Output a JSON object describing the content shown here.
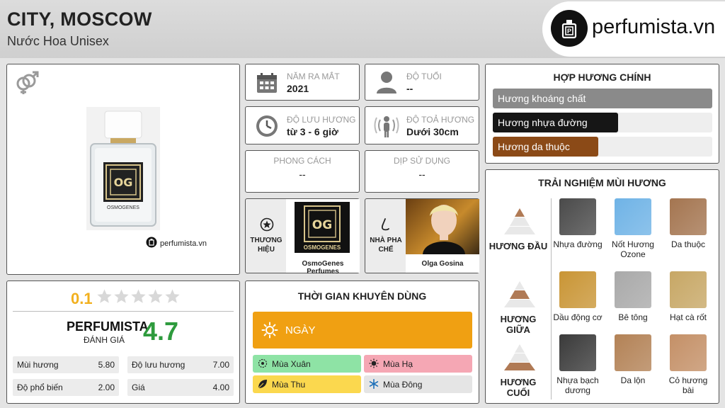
{
  "header": {
    "title": "CITY, MOSCOW",
    "subtitle": "Nước Hoa Unisex",
    "logo_text": "perfumista.vn"
  },
  "product": {
    "watermark": "perfumista.vn",
    "bottle_brand": "OSMOGENES"
  },
  "info": {
    "release_year": {
      "label": "NĂM RA MẮT",
      "value": "2021"
    },
    "age": {
      "label": "ĐỘ TUỔI",
      "value": "--"
    },
    "longevity": {
      "label": "ĐỘ LƯU HƯƠNG",
      "value": "từ 3 - 6 giờ"
    },
    "sillage": {
      "label": "ĐỘ TOẢ HƯƠNG",
      "value": "Dưới 30cm"
    },
    "style": {
      "label": "PHONG CÁCH",
      "value": "--"
    },
    "occasion": {
      "label": "DỊP SỬ DỤNG",
      "value": "--"
    },
    "brand": {
      "label_line1": "THƯƠNG",
      "label_line2": "HIỆU",
      "name": "OsmoGenes Perfumes",
      "logo_text": "OSMOGENES"
    },
    "perfumer": {
      "label_line1": "NHÀ PHA",
      "label_line2": "CHẾ",
      "name": "Olga Gosina"
    }
  },
  "accords": {
    "title": "HỢP HƯƠNG CHÍNH",
    "items": [
      {
        "label": "Hương khoáng chất",
        "fraction": 1.0,
        "color": "#8a8a8a"
      },
      {
        "label": "Hương nhựa đường",
        "fraction": 0.57,
        "color": "#161616"
      },
      {
        "label": "Hương da thuộc",
        "fraction": 0.48,
        "color": "#8b4a17"
      }
    ]
  },
  "notes": {
    "title": "TRẢI NGHIỆM MÙI HƯƠNG",
    "tiers": [
      {
        "label": "HƯƠNG ĐẦU",
        "notes": [
          {
            "name_line1": "Nhựa đường",
            "name_line2": "",
            "color": "#4a4a4a"
          },
          {
            "name_line1": "Nốt Hương",
            "name_line2": "Ozone",
            "color": "#6fb3e6"
          },
          {
            "name_line1": "Da thuộc",
            "name_line2": "",
            "color": "#a47550"
          }
        ]
      },
      {
        "label": "HƯƠNG GIỮA",
        "notes": [
          {
            "name_line1": "Dầu động cơ",
            "name_line2": "",
            "color": "#c99535"
          },
          {
            "name_line1": "Bê tông",
            "name_line2": "",
            "color": "#a9a9a9"
          },
          {
            "name_line1": "Hạt cà rốt",
            "name_line2": "",
            "color": "#c7a765"
          }
        ]
      },
      {
        "label": "HƯƠNG CUỐI",
        "notes": [
          {
            "name_line1": "Nhựa bạch",
            "name_line2": "dương",
            "color": "#3a3a3a"
          },
          {
            "name_line1": "Da lộn",
            "name_line2": "",
            "color": "#b38256"
          },
          {
            "name_line1": "Cỏ hương",
            "name_line2": "bài",
            "color": "#c49067"
          }
        ]
      }
    ]
  },
  "rating": {
    "score": "0.1",
    "stars_filled": 0,
    "stars_total": 5,
    "perfumista_label": "PERFUMISTA",
    "perfumista_sub": "ĐÁNH GIÁ",
    "perfumista_score": "4.7",
    "metrics": [
      {
        "name": "Mùi hương",
        "value": "5.80"
      },
      {
        "name": "Độ lưu hương",
        "value": "7.00"
      },
      {
        "name": "Độ phổ biến",
        "value": "2.00"
      },
      {
        "name": "Giá",
        "value": "4.00"
      }
    ]
  },
  "time": {
    "title": "THỜI GIAN KHUYÊN DÙNG",
    "day_label": "NGÀY",
    "seasons": [
      {
        "label": "Mùa Xuân",
        "color": "#8ee3a5"
      },
      {
        "label": "Mùa Hạ",
        "color": "#f5a7b4"
      },
      {
        "label": "Mùa Thu",
        "color": "#fbd84e"
      },
      {
        "label": "Mùa Đông",
        "color": "#e5e5e5"
      }
    ]
  },
  "colors": {
    "accent_orange": "#f0a012",
    "rating_gold": "#f2b01e",
    "score_green": "#2e9b3d"
  }
}
